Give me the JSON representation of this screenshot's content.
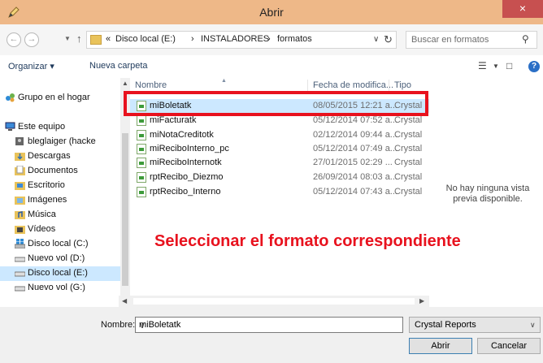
{
  "window": {
    "title": "Abrir",
    "close_symbol": "×"
  },
  "address": {
    "prefix": "«",
    "crumbs": [
      "Disco local (E:)",
      "INSTALADORES",
      "formatos"
    ],
    "separator": "›"
  },
  "search": {
    "placeholder": "Buscar en formatos"
  },
  "toolbar": {
    "organize": "Organizar ▾",
    "new_folder": "Nueva carpeta"
  },
  "nav": {
    "items": [
      {
        "label": "Grupo en el hogar"
      },
      {
        "label": "Este equipo"
      },
      {
        "label": "bleglaiger (hacke"
      },
      {
        "label": "Descargas"
      },
      {
        "label": "Documentos"
      },
      {
        "label": "Escritorio"
      },
      {
        "label": "Imágenes"
      },
      {
        "label": "Música"
      },
      {
        "label": "Vídeos"
      },
      {
        "label": "Disco local (C:)"
      },
      {
        "label": "Nuevo vol (D:)"
      },
      {
        "label": "Disco local (E:)"
      },
      {
        "label": "Nuevo vol (G:)"
      }
    ]
  },
  "columns": {
    "name": "Nombre",
    "date": "Fecha de modifica...",
    "type": "Tipo"
  },
  "files": [
    {
      "name": "miBoletatk",
      "date": "08/05/2015 12:21 a...",
      "type": "Crystal"
    },
    {
      "name": "miFacturatk",
      "date": "05/12/2014 07:52 a...",
      "type": "Crystal"
    },
    {
      "name": "miNotaCreditotk",
      "date": "02/12/2014 09:44 a...",
      "type": "Crystal"
    },
    {
      "name": "miReciboInterno_pc",
      "date": "05/12/2014 07:49 a...",
      "type": "Crystal"
    },
    {
      "name": "miReciboInternotk",
      "date": "27/01/2015 02:29 ...",
      "type": "Crystal"
    },
    {
      "name": "rptRecibo_Diezmo",
      "date": "26/09/2014 08:03 a...",
      "type": "Crystal"
    },
    {
      "name": "rptRecibo_Interno",
      "date": "05/12/2014 07:43 a...",
      "type": "Crystal"
    }
  ],
  "preview": {
    "text": "No hay ninguna vista previa disponible."
  },
  "annotation": "Seleccionar el formato correspondiente",
  "footer": {
    "name_label": "Nombre:",
    "name_value": "miBoletatk",
    "file_type": "Crystal Reports",
    "open_label": "Abrir",
    "cancel_label": "Cancelar"
  },
  "colors": {
    "titlebar": "#eeb888",
    "highlight": "#e8121e",
    "selection": "#cce8ff"
  }
}
